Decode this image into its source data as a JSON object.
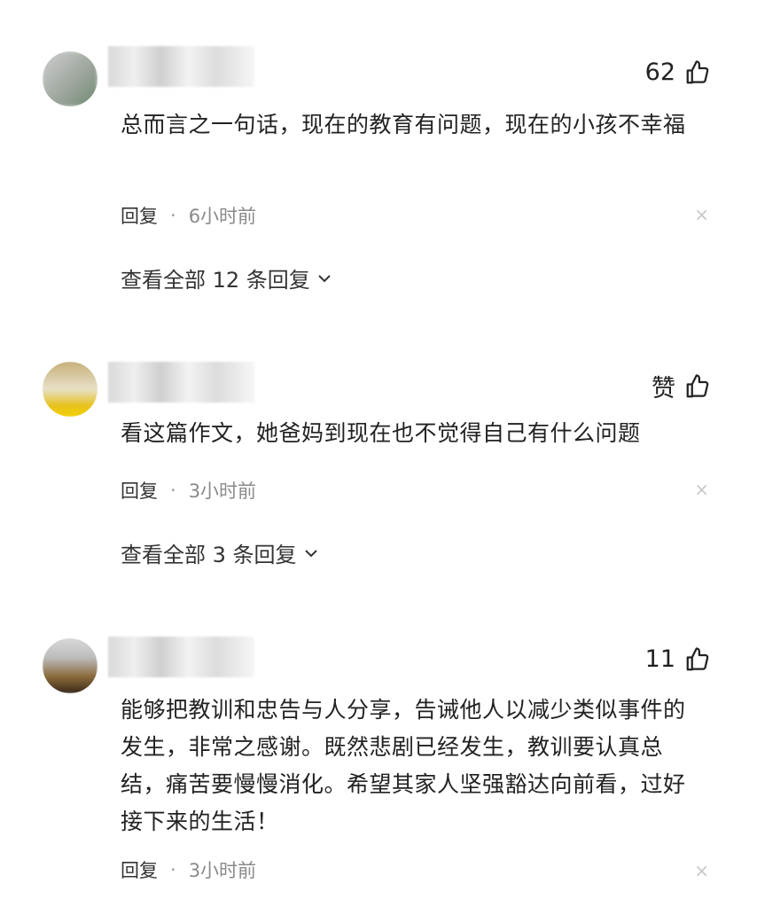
{
  "comments": [
    {
      "likes": "62",
      "text": "总而言之一句话，现在的教育有问题，现在的小孩不幸福",
      "reply_label": "回复",
      "dot": "·",
      "time": "6小时前",
      "close": "×",
      "view_replies": "查看全部 12 条回复"
    },
    {
      "likes": "赞",
      "text": "看这篇作文，她爸妈到现在也不觉得自己有什么问题",
      "reply_label": "回复",
      "dot": "·",
      "time": "3小时前",
      "close": "×",
      "view_replies": "查看全部 3 条回复"
    },
    {
      "likes": "11",
      "text": "能够把教训和忠告与人分享，告诫他人以减少类似事件的发生，非常之感谢。既然悲剧已经发生，教训要认真总结，痛苦要慢慢消化。希望其家人坚强豁达向前看，过好接下来的生活！",
      "reply_label": "回复",
      "dot": "·",
      "time": "3小时前",
      "close": "×"
    }
  ],
  "icons": {
    "like": "thumbs-up-icon",
    "expand": "chevron-down-icon",
    "dismiss": "close-icon"
  },
  "colors": {
    "text": "#222222",
    "meta": "#8a8a8a",
    "close": "#c8c8c8"
  }
}
